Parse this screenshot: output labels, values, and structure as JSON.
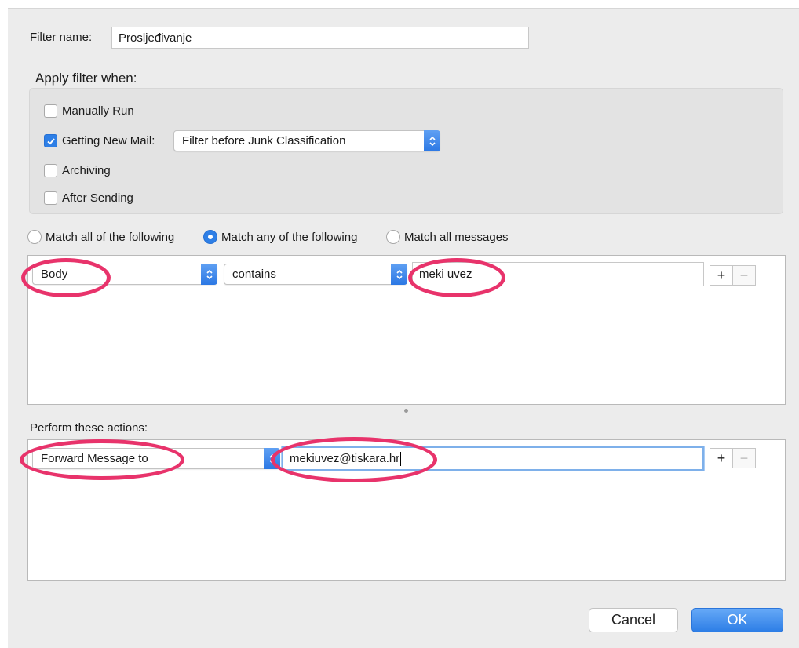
{
  "filter_name": {
    "label": "Filter name:",
    "value": "Prosljeđivanje"
  },
  "apply_when": {
    "heading": "Apply filter when:",
    "options": [
      {
        "label": "Manually Run",
        "checked": false
      },
      {
        "label": "Getting New Mail:",
        "checked": true
      },
      {
        "label": "Archiving",
        "checked": false
      },
      {
        "label": "After Sending",
        "checked": false
      }
    ],
    "getting_new_mail_select": "Filter before Junk Classification"
  },
  "match_mode": {
    "options": [
      {
        "label": "Match all of the following",
        "selected": false
      },
      {
        "label": "Match any of the following",
        "selected": true
      },
      {
        "label": "Match all messages",
        "selected": false
      }
    ]
  },
  "criteria": {
    "rows": [
      {
        "field": "Body",
        "operator": "contains",
        "value": "meki uvez"
      }
    ],
    "add_label": "+",
    "remove_label": "−"
  },
  "actions": {
    "heading": "Perform these actions:",
    "rows": [
      {
        "action": "Forward Message to",
        "value": "mekiuvez@tiskara.hr"
      }
    ],
    "add_label": "+",
    "remove_label": "−"
  },
  "buttons": {
    "cancel": "Cancel",
    "ok": "OK"
  },
  "colors": {
    "accent": "#2e7fe6",
    "highlight": "#e8336b"
  }
}
